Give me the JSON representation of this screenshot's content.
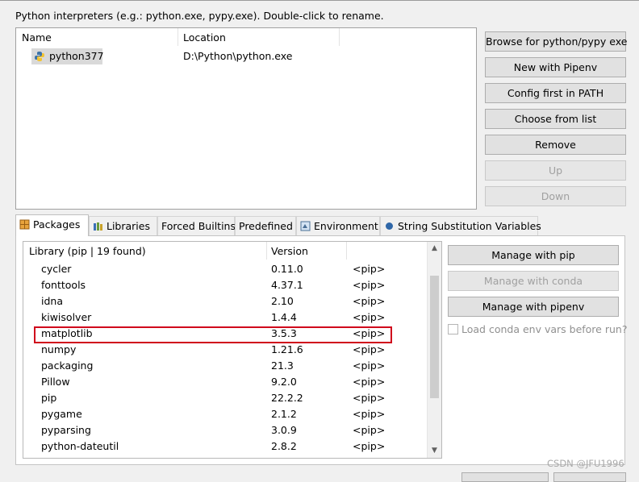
{
  "hint": "Python interpreters (e.g.: python.exe, pypy.exe).   Double-click to rename.",
  "interpreters": {
    "columns": [
      "Name",
      "Location"
    ],
    "rows": [
      {
        "name": "python377",
        "location": "D:\\Python\\python.exe",
        "icon": "python-icon"
      }
    ]
  },
  "side_buttons": [
    {
      "label": "Browse for python/pypy exe",
      "enabled": true
    },
    {
      "label": "New with Pipenv",
      "enabled": true
    },
    {
      "label": "Config first in PATH",
      "enabled": true
    },
    {
      "label": "Choose from list",
      "enabled": true
    },
    {
      "label": "Remove",
      "enabled": true
    },
    {
      "label": "Up",
      "enabled": false
    },
    {
      "label": "Down",
      "enabled": false
    }
  ],
  "tabs": [
    {
      "label": "Packages",
      "icon": "package-icon",
      "active": true
    },
    {
      "label": "Libraries",
      "icon": "libraries-icon"
    },
    {
      "label": "Forced Builtins"
    },
    {
      "label": "Predefined"
    },
    {
      "label": "Environment",
      "icon": "environment-icon"
    },
    {
      "label": "String Substitution Variables",
      "icon": "variable-icon"
    }
  ],
  "packages": {
    "columns": [
      "Library (pip | 19 found)",
      "Version"
    ],
    "rows": [
      {
        "name": "cycler",
        "version": "0.11.0",
        "source": "<pip>"
      },
      {
        "name": "fonttools",
        "version": "4.37.1",
        "source": "<pip>"
      },
      {
        "name": "idna",
        "version": "2.10",
        "source": "<pip>"
      },
      {
        "name": "kiwisolver",
        "version": "1.4.4",
        "source": "<pip>"
      },
      {
        "name": "matplotlib",
        "version": "3.5.3",
        "source": "<pip>"
      },
      {
        "name": "numpy",
        "version": "1.21.6",
        "source": "<pip>"
      },
      {
        "name": "packaging",
        "version": "21.3",
        "source": "<pip>"
      },
      {
        "name": "Pillow",
        "version": "9.2.0",
        "source": "<pip>"
      },
      {
        "name": "pip",
        "version": "22.2.2",
        "source": "<pip>"
      },
      {
        "name": "pygame",
        "version": "2.1.2",
        "source": "<pip>"
      },
      {
        "name": "pyparsing",
        "version": "3.0.9",
        "source": "<pip>"
      },
      {
        "name": "python-dateutil",
        "version": "2.8.2",
        "source": "<pip>"
      }
    ]
  },
  "package_buttons": [
    {
      "label": "Manage with pip",
      "enabled": true
    },
    {
      "label": "Manage with conda",
      "enabled": false
    },
    {
      "label": "Manage with pipenv",
      "enabled": true
    }
  ],
  "conda_checkbox": "Load conda env vars before run?",
  "watermark": "CSDN @JFU1996",
  "colors": {
    "highlight": "#d0021b",
    "button": "#e1e1e1",
    "selection": "#d9d9d9"
  }
}
